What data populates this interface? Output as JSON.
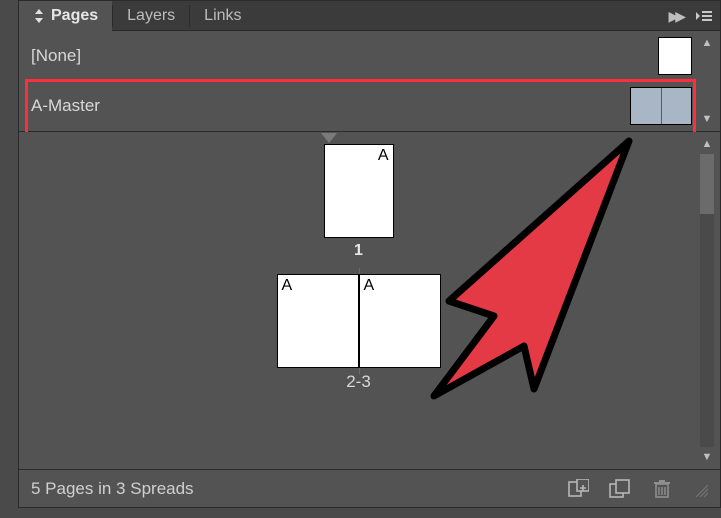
{
  "tabs": {
    "pages": "Pages",
    "layers": "Layers",
    "links": "Links"
  },
  "masters": {
    "none": "[None]",
    "a_master": "A-Master"
  },
  "pages": {
    "letter_a_1": "A",
    "letter_a_2": "A",
    "letter_a_3": "A",
    "num_1": "1",
    "spread_label": "2-3"
  },
  "footer": {
    "status": "5 Pages in 3 Spreads"
  }
}
